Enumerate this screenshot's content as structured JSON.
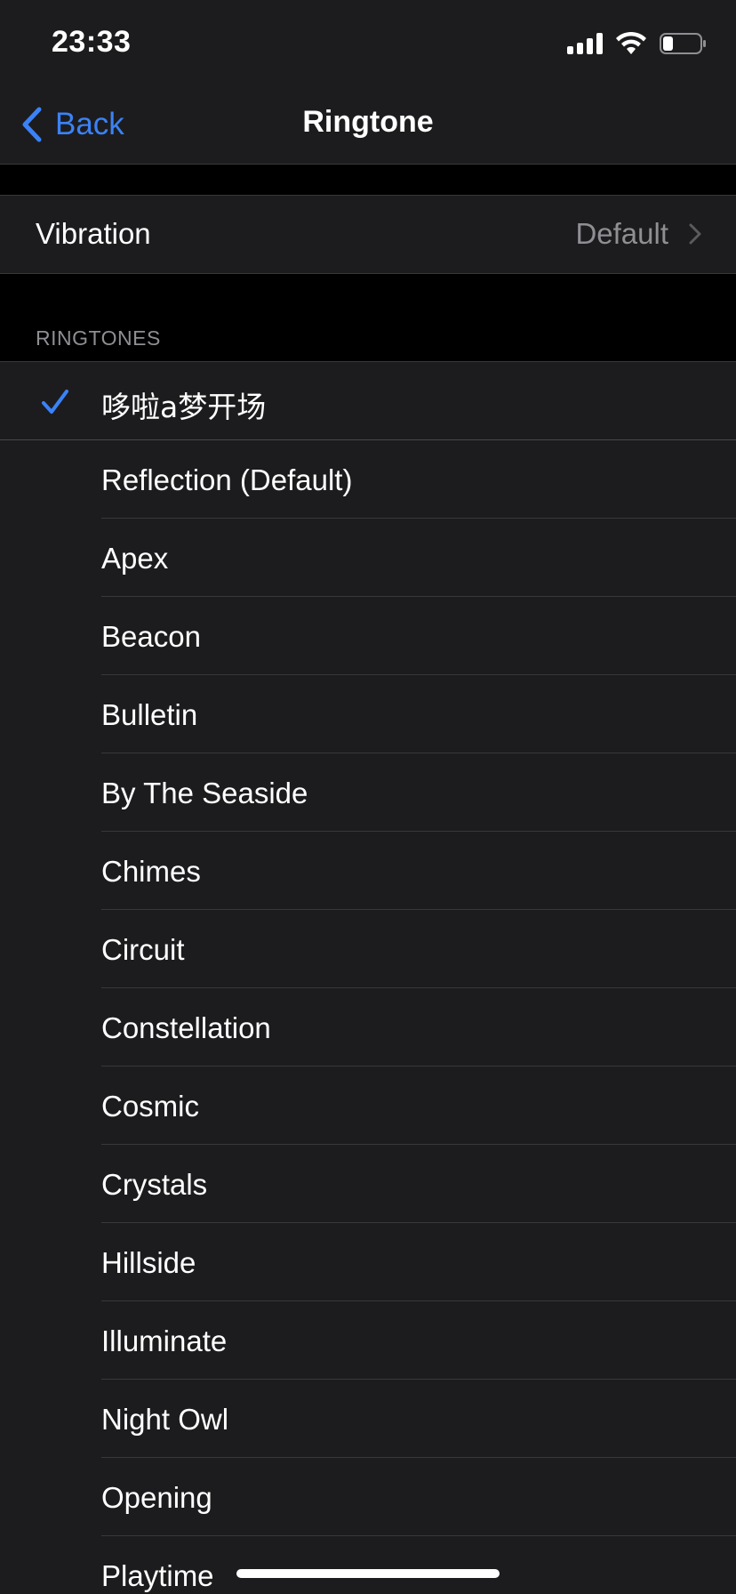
{
  "status_bar": {
    "time": "23:33"
  },
  "nav": {
    "back_label": "Back",
    "title": "Ringtone"
  },
  "vibration": {
    "label": "Vibration",
    "value": "Default"
  },
  "section": {
    "header": "RINGTONES"
  },
  "selected_ringtone": "哆啦a梦开场",
  "ringtones": [
    "Reflection (Default)",
    "Apex",
    "Beacon",
    "Bulletin",
    "By The Seaside",
    "Chimes",
    "Circuit",
    "Constellation",
    "Cosmic",
    "Crystals",
    "Hillside",
    "Illuminate",
    "Night Owl",
    "Opening",
    "Playtime"
  ],
  "colors": {
    "accent": "#3b82f6",
    "background": "#000000",
    "cell": "#1c1c1e",
    "secondary_text": "#8e8e93"
  }
}
